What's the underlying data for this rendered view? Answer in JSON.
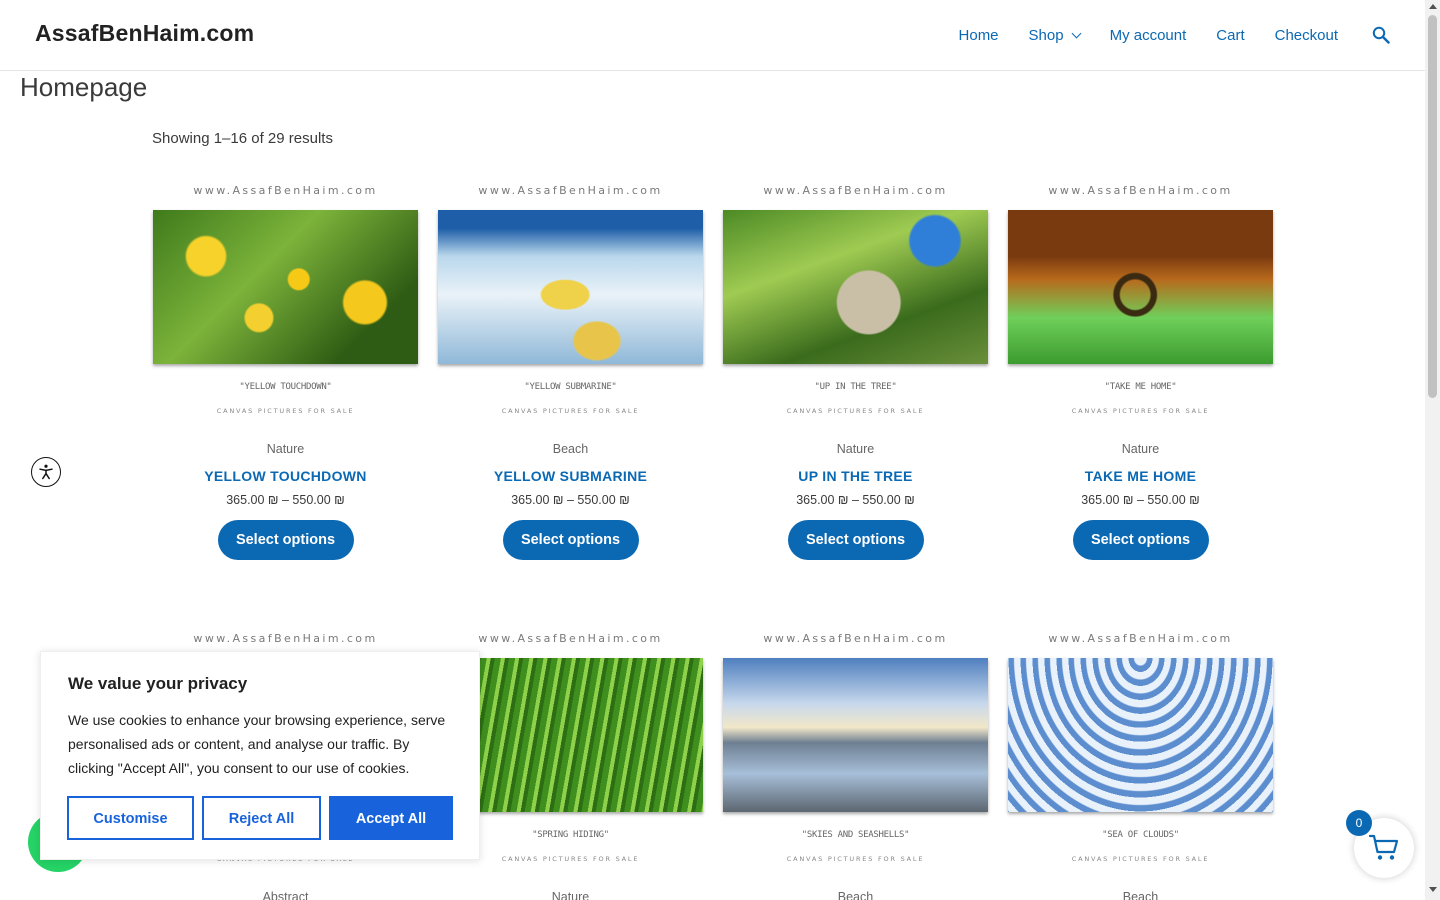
{
  "header": {
    "site_title": "AssafBenHaim.com",
    "nav": [
      {
        "label": "Home"
      },
      {
        "label": "Shop",
        "has_dropdown": true
      },
      {
        "label": "My account"
      },
      {
        "label": "Cart"
      },
      {
        "label": "Checkout"
      }
    ],
    "search_icon": "search-icon"
  },
  "page": {
    "title": "Homepage",
    "result_count": "Showing 1–16 of 29 results"
  },
  "watermark": "www.AssafBenHaim.com",
  "canvas_label": "CANVAS PICTURES FOR SALE",
  "products": [
    {
      "img_title": "\"YELLOW TOUCHDOWN\"",
      "category": "Nature",
      "name": "YELLOW TOUCHDOWN",
      "price": "365.00 ₪ – 550.00 ₪",
      "button": "Select options"
    },
    {
      "img_title": "\"YELLOW SUBMARINE\"",
      "category": "Beach",
      "name": "YELLOW SUBMARINE",
      "price": "365.00 ₪ – 550.00 ₪",
      "button": "Select options"
    },
    {
      "img_title": "\"UP IN THE TREE\"",
      "category": "Nature",
      "name": "UP IN THE TREE",
      "price": "365.00 ₪ – 550.00 ₪",
      "button": "Select options"
    },
    {
      "img_title": "\"TAKE ME HOME\"",
      "category": "Nature",
      "name": "TAKE ME HOME",
      "price": "365.00 ₪ – 550.00 ₪",
      "button": "Select options"
    },
    {
      "img_title": "",
      "category": "Abstract"
    },
    {
      "img_title": "\"SPRING HIDING\"",
      "category": "Nature"
    },
    {
      "img_title": "\"SKIES AND SEASHELLS\"",
      "category": "Beach"
    },
    {
      "img_title": "\"SEA OF CLOUDS\"",
      "category": "Beach"
    }
  ],
  "cookie_banner": {
    "title": "We value your privacy",
    "body": "We use cookies to enhance your browsing experience, serve personalised ads or content, and analyse our traffic. By clicking \"Accept All\", you consent to our use of cookies.",
    "customise": "Customise",
    "reject": "Reject All",
    "accept": "Accept All",
    "accent_color": "#1863dc"
  },
  "mini_cart": {
    "count": "0",
    "icon": "cart-icon"
  },
  "accessibility_icon": "accessibility-icon",
  "colors": {
    "link": "#0b69b4",
    "button": "#0b69b4",
    "whatsapp": "#25d366"
  }
}
